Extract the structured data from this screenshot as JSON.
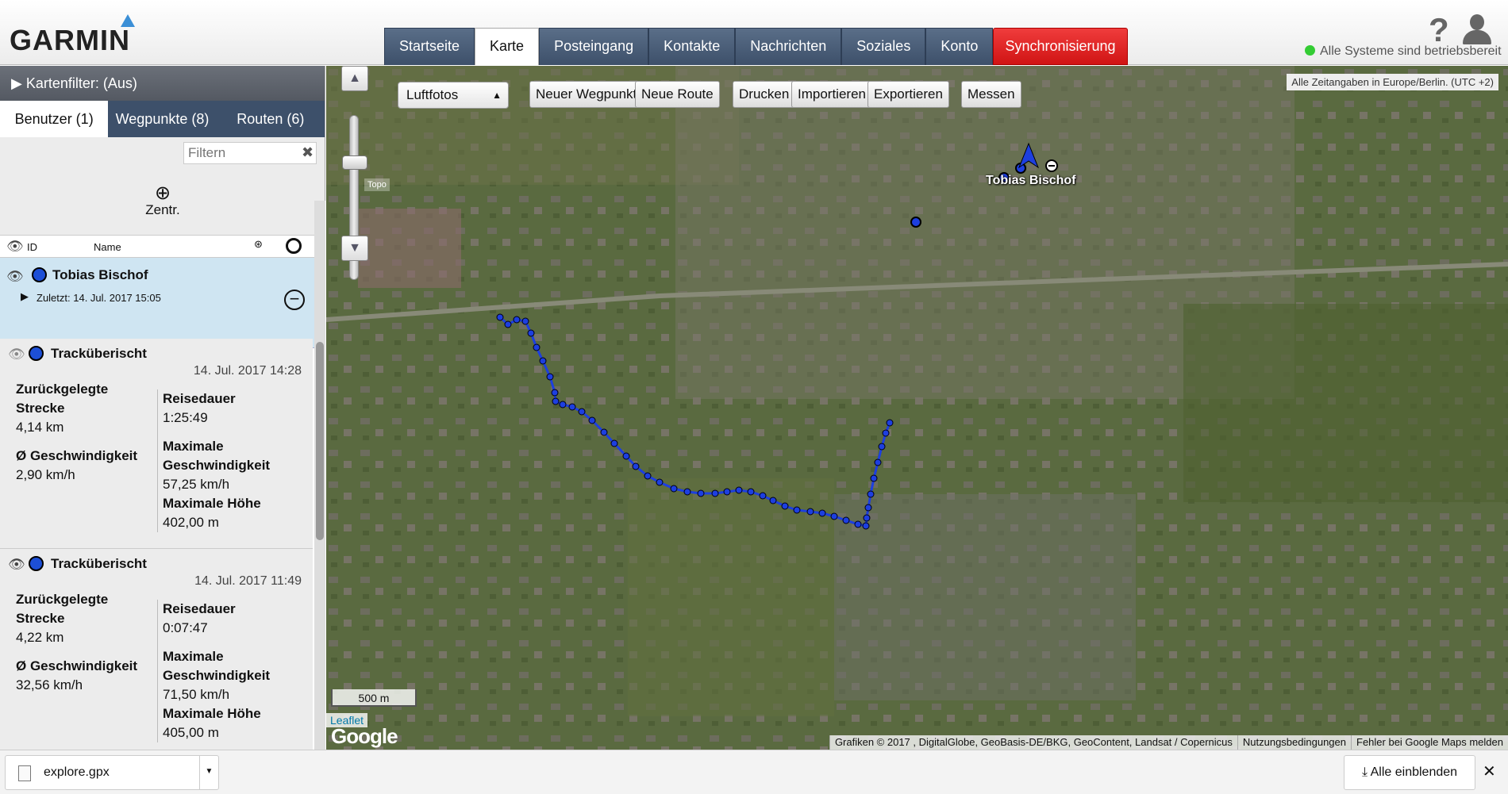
{
  "header": {
    "logo": "GARMIN",
    "tabs": [
      "Startseite",
      "Karte",
      "Posteingang",
      "Kontakte",
      "Nachrichten",
      "Soziales",
      "Konto"
    ],
    "active_tab": "Karte",
    "sync_label": "Synchronisierung",
    "help": "?",
    "status": "Alle Systeme sind betriebsbereit",
    "status_color": "#33cc33"
  },
  "sidebar": {
    "map_filter": "▶ Kartenfilter: (Aus)",
    "tabs": [
      "Benutzer (1)",
      "Wegpunkte (8)",
      "Routen (6)"
    ],
    "filter_placeholder": "Filtern",
    "center_label": "Zentr.",
    "list_headers": {
      "id": "ID",
      "name": "Name"
    },
    "user": {
      "name": "Tobias Bischof",
      "last": "Zuletzt: 14. Jul. 2017 15:05"
    },
    "tracks": [
      {
        "title": "Tracküberischt",
        "date": "14. Jul. 2017 14:28",
        "distance_label": "Zurückgelegte Strecke",
        "distance": "4,14 km",
        "speed_label": "Ø Geschwindigkeit",
        "speed": "2,90 km/h",
        "duration_label": "Reisedauer",
        "duration": "1:25:49",
        "maxspeed_label": "Maximale Geschwindigkeit",
        "maxspeed": "57,25 km/h",
        "maxalt_label": "Maximale Höhe",
        "maxalt": "402,00 m"
      },
      {
        "title": "Tracküberischt",
        "date": "14. Jul. 2017 11:49",
        "distance_label": "Zurückgelegte Strecke",
        "distance": "4,22 km",
        "speed_label": "Ø Geschwindigkeit",
        "speed": "32,56 km/h",
        "duration_label": "Reisedauer",
        "duration": "0:07:47",
        "maxspeed_label": "Maximale Geschwindigkeit",
        "maxspeed": "71,50 km/h",
        "maxalt_label": "Maximale Höhe",
        "maxalt": "405,00 m"
      }
    ]
  },
  "map": {
    "layer_select": "Luftfotos",
    "buttons": {
      "new_waypoint": "Neuer Wegpunkt",
      "new_route": "Neue Route",
      "print": "Drucken",
      "import": "Importieren",
      "export": "Exportieren",
      "measure": "Messen"
    },
    "topo": "Topo",
    "timezone": "Alle Zeitangaben in Europe/Berlin. (UTC +2)",
    "scale": "500 m",
    "leaflet": "Leaflet",
    "google": "Google",
    "user_label": "Tobias Bischof",
    "attribution": [
      "Grafiken © 2017 , DigitalGlobe, GeoBasis-DE/BKG, GeoContent, Landsat / Copernicus",
      "Nutzungsbedingungen",
      "Fehler bei Google Maps melden"
    ],
    "track_color": "#1d3fe0"
  },
  "download": {
    "file": "explore.gpx",
    "show_all": "Alle einblenden",
    "close": "✕"
  }
}
